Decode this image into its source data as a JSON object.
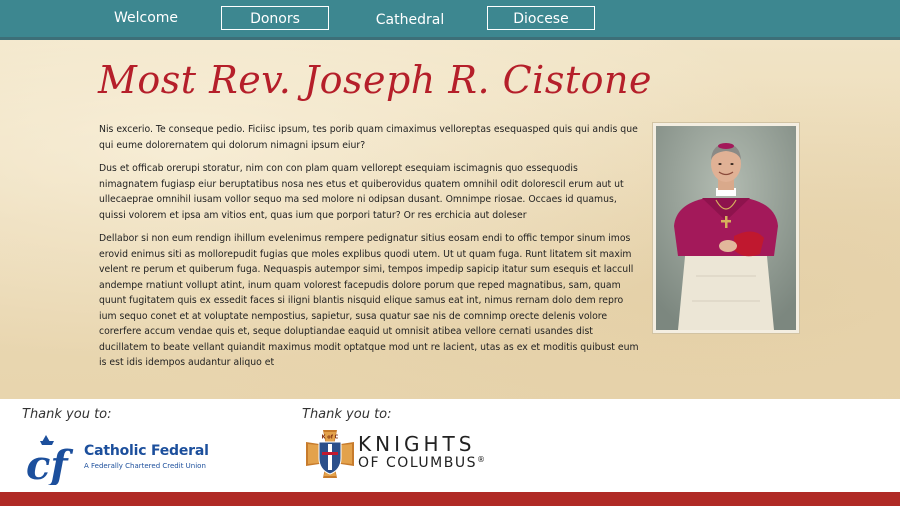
{
  "nav": {
    "items": [
      {
        "label": "Welcome",
        "boxed": false
      },
      {
        "label": "Donors",
        "boxed": true
      },
      {
        "label": "Cathedral",
        "boxed": false
      },
      {
        "label": "Diocese",
        "boxed": true
      }
    ]
  },
  "page": {
    "title": "Most Rev. Joseph R. Cistone",
    "paragraphs": [
      "Nis excerio. Te conseque pedio. Ficiisc ipsum, tes porib quam cimaximus velloreptas esequasped quis qui andis que qui eume dolorernatem qui dolorum nimagni ipsum eiur?",
      "Dus et officab orerupi storatur, nim con con plam quam vellorept esequiam iscimagnis quo essequodis nimagnatem fugiasp eiur beruptatibus nosa nes etus et quiberovidus quatem omnihil odit dolorescil erum aut ut ullecaeprae omnihil iusam vollor sequo ma sed molore ni odipsan dusant. Omnimpe riosae. Occaes id quamus, quissi volorem et ipsa am vitios ent, quas ium que porpori tatur? Or res erchicia aut doleser",
      "Dellabor si non eum rendign ihillum evelenimus rempere pedignatur sitius eosam endi to offic tempor sinum imos erovid enimus siti as mollorepudit fugias que moles explibus quodi utem. Ut ut quam fuga. Runt litatem sit maxim velent re perum et quiberum fuga. Nequaspis autempor simi, tempos impedip sapicip itatur sum esequis et laccull andempe rnatiunt vollupt atint, inum quam volorest facepudis dolore porum que reped magnatibus, sam, quam quunt fugitatem quis ex essedit faces si iligni blantis nisquid elique samus eat int, nimus rernam dolo dem repro ium sequo conet et at voluptate nempostius, sapietur, susa quatur sae nis de comnimp orecte delenis volore corerfere accum vendae quis et, seque doluptiandae eaquid ut omnisit atibea vellore cernati usandes dist ducillatem to beate vellant quiandit maximus modit optatque mod unt re lacient, utas as ex et moditis quibust eum is est idis idempos audantur aliquo et"
    ]
  },
  "sponsors": [
    {
      "thank_label": "Thank you to:",
      "name": "Catholic Federal",
      "tagline": "A Federally Chartered Credit Union",
      "mark_text": "cf"
    },
    {
      "thank_label": "Thank you to:",
      "name_line1": "KNIGHTS",
      "name_line2": "OF COLUMBUS",
      "reg_mark": "®",
      "emblem_text": "K of C"
    }
  ],
  "colors": {
    "nav_bg": "#3d8790",
    "title_red": "#b51f2a",
    "bottom_bar": "#b02a26",
    "cf_blue": "#1c4f9c"
  },
  "icons": {
    "portrait": "bishop-portrait-image",
    "cf_mark": "catholic-federal-logo-icon",
    "kc_emblem": "knights-of-columbus-emblem-icon"
  }
}
